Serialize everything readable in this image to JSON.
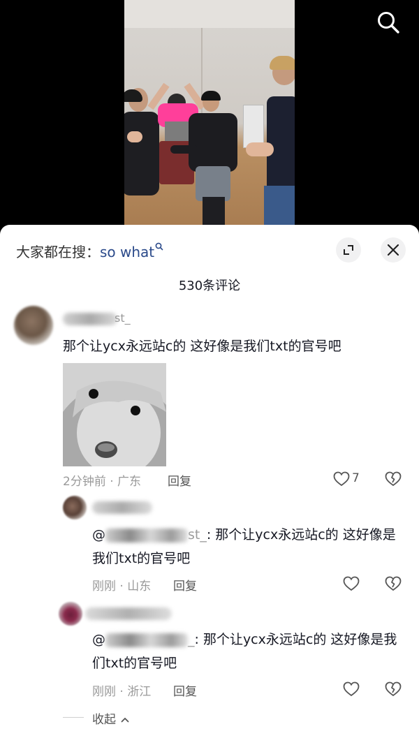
{
  "video": {
    "search_icon": "search-icon"
  },
  "sheet": {
    "hot_search_prefix": "大家都在搜：",
    "hot_search_query": "so what",
    "expand_icon": "expand-icon",
    "close_icon": "close-icon",
    "comment_count": "530条评论"
  },
  "comments": [
    {
      "username_visible": "st_",
      "text": "那个让ycx永远站c的 这好像是我们txt的官号吧",
      "time": "2分钟前",
      "location": "广东",
      "meta": "2分钟前 · 广东",
      "reply_label": "回复",
      "likes": "7",
      "replies": [
        {
          "mention_prefix": "@",
          "mention_tail": "st_",
          "text": ": 那个让ycx永远站c的 这好像是我们txt的官号吧",
          "meta": "刚刚 · 山东",
          "reply_label": "回复"
        },
        {
          "mention_prefix": "@",
          "mention_tail": "_",
          "text": ": 那个让ycx永远站c的 这好像是我们txt的官号吧",
          "meta": "刚刚 · 浙江",
          "reply_label": "回复"
        }
      ]
    }
  ],
  "collapse_label": "收起"
}
